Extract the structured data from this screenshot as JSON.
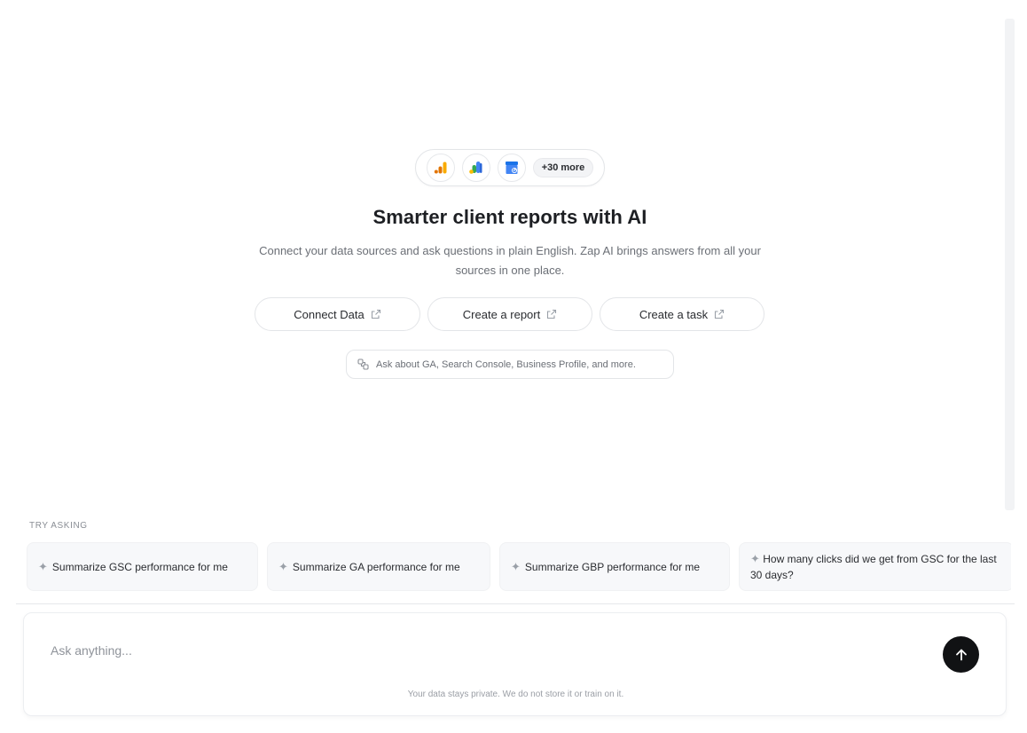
{
  "hero": {
    "sources": [
      {
        "icon": "google-analytics-icon"
      },
      {
        "icon": "google-ads-icon"
      },
      {
        "icon": "google-business-profile-icon"
      }
    ],
    "more_badge": "+30 more",
    "title": "Smarter client reports with AI",
    "subtitle": "Connect your data sources and ask questions in plain English. Zap AI brings answers from all your sources in one place."
  },
  "actions": [
    {
      "label": "Connect Data",
      "icon": "external-link-icon"
    },
    {
      "label": "Create a report",
      "icon": "external-link-icon"
    },
    {
      "label": "Create a task",
      "icon": "external-link-icon"
    }
  ],
  "hint": {
    "icon": "link-icon",
    "text": "Ask about GA, Search Console, Business Profile, and more."
  },
  "try_asking": {
    "label": "TRY ASKING",
    "suggestions": [
      "Summarize GSC performance for me",
      "Summarize GA performance for me",
      "Summarize GBP performance for me",
      "How many clicks did we get from GSC for the last 30 days?"
    ]
  },
  "composer": {
    "placeholder": "Ask anything...",
    "send_icon": "arrow-up-icon",
    "privacy_note": "Your data stays private. We do not store it or train on it."
  },
  "colors": {
    "send_button": "#111214",
    "ga_orange": "#F9AB00",
    "ga_dark_orange": "#E37400",
    "ads_blue": "#4285F4",
    "ads_yellow": "#FBBC04",
    "ads_green": "#34A853",
    "gbp_blue": "#4285F4"
  }
}
